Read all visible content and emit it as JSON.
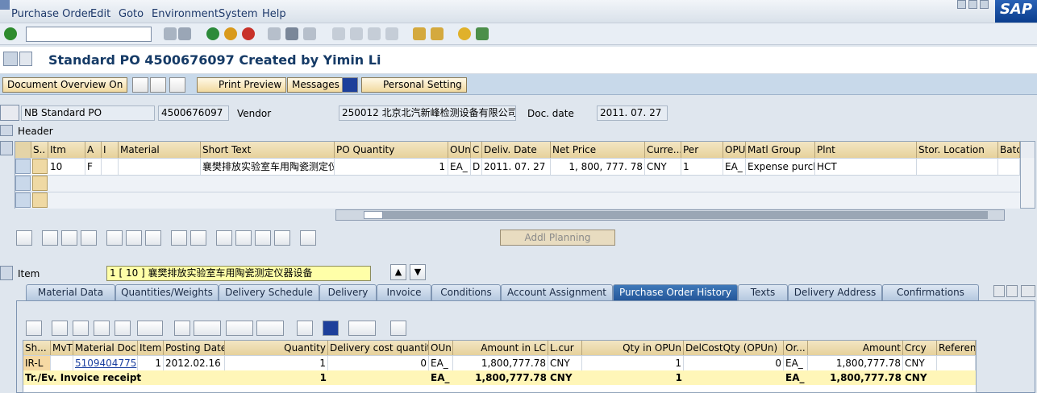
{
  "menu": {
    "items": [
      "Purchase Order",
      "Edit",
      "Goto",
      "Environment",
      "System",
      "Help"
    ]
  },
  "logo": "SAP",
  "title": "Standard PO 4500676097 Created by Yimin Li",
  "app_toolbar": {
    "document_overview": "Document Overview On",
    "print_preview": "Print Preview",
    "messages": "Messages",
    "personal_setting": "Personal Setting"
  },
  "header": {
    "doc_type": "NB Standard PO",
    "po_number": "4500676097",
    "vendor_label": "Vendor",
    "vendor": "250012 北京北汽新峰检测设备有限公司",
    "doc_date_label": "Doc. date",
    "doc_date": "2011. 07. 27",
    "section": "Header"
  },
  "items_grid": {
    "columns": [
      "S..",
      "Itm",
      "A",
      "I",
      "Material",
      "Short Text",
      "PO Quantity",
      "OUn",
      "C",
      "Deliv. Date",
      "Net Price",
      "Curre...",
      "Per",
      "OPU",
      "Matl Group",
      "Plnt",
      "Stor. Location",
      "Batc"
    ],
    "row": {
      "itm": "10",
      "a": "F",
      "i": "",
      "material": "",
      "short_text": "襄樊排放实验室车用陶瓷测定仪",
      "po_qty": "1",
      "oun": "EA_",
      "c": "D",
      "deliv_date": "2011. 07. 27",
      "net_price": "1, 800, 777. 78",
      "curr": "CNY",
      "per": "1",
      "opu": "EA_",
      "matl_group": "Expense purcha",
      "plnt": "HCT",
      "stor": "",
      "batch": ""
    }
  },
  "addl_planning": "Addl Planning",
  "item": {
    "label": "Item",
    "selected": "1 [ 10 ] 襄樊排放实验室车用陶瓷测定仪器设备"
  },
  "tabs": [
    "Material Data",
    "Quantities/Weights",
    "Delivery Schedule",
    "Delivery",
    "Invoice",
    "Conditions",
    "Account Assignment",
    "Purchase Order History",
    "Texts",
    "Delivery Address",
    "Confirmations"
  ],
  "active_tab": "Purchase Order History",
  "history": {
    "columns": [
      "Sh...",
      "MvT",
      "Material Doc...",
      "Item",
      "Posting Date",
      "Quantity",
      "Delivery cost quantity",
      "OUn",
      "Amount in LC",
      "L.cur",
      "Qty in OPUn",
      "DelCostQty (OPUn)",
      "Or...",
      "Amount",
      "Crcy",
      "Referenc"
    ],
    "row": {
      "sh": "IR-L",
      "mvt": "",
      "mat_doc": "5109404775",
      "item": "1",
      "posting_date": "2012.02.16",
      "quantity": "1",
      "del_cost_qty": "0",
      "oun": "EA_",
      "amount_lc": "1,800,777.78",
      "lcur": "CNY",
      "qty_opun": "1",
      "delcost_opun": "0",
      "or": "EA_",
      "amount": "1,800,777.78",
      "crcy": "CNY",
      "ref": ""
    },
    "sum": {
      "label": "Tr./Ev. Invoice receipt",
      "quantity": "1",
      "oun": "EA_",
      "amount_lc": "1,800,777.78",
      "lcur": "CNY",
      "qty_opun": "1",
      "or": "EA_",
      "amount": "1,800,777.78",
      "crcy": "CNY"
    }
  },
  "colors": {
    "title": "#153a66",
    "active_tab": "#2a5d9f",
    "header_cell": "#ead7a6",
    "sum_row": "#fff6b8"
  }
}
